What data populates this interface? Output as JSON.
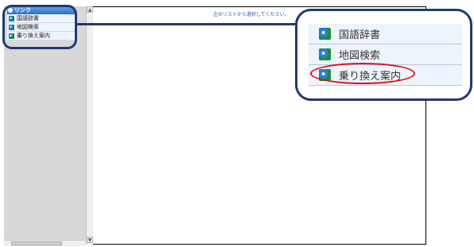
{
  "instruction": "左のリストから選択してください。",
  "sidebar": {
    "header": "リンク",
    "items": [
      {
        "label": "国語辞書",
        "icon": "globe-icon"
      },
      {
        "label": "地図検索",
        "icon": "globe-icon"
      },
      {
        "label": "乗り換え案内",
        "icon": "globe-icon"
      }
    ]
  },
  "zoom": {
    "items": [
      {
        "label": "国語辞書",
        "icon": "globe-icon"
      },
      {
        "label": "地図検索",
        "icon": "globe-icon"
      },
      {
        "label": "乗り換え案内",
        "icon": "globe-icon"
      }
    ],
    "highlight_color": "#e0101b",
    "callout_color": "#1f3b72"
  }
}
